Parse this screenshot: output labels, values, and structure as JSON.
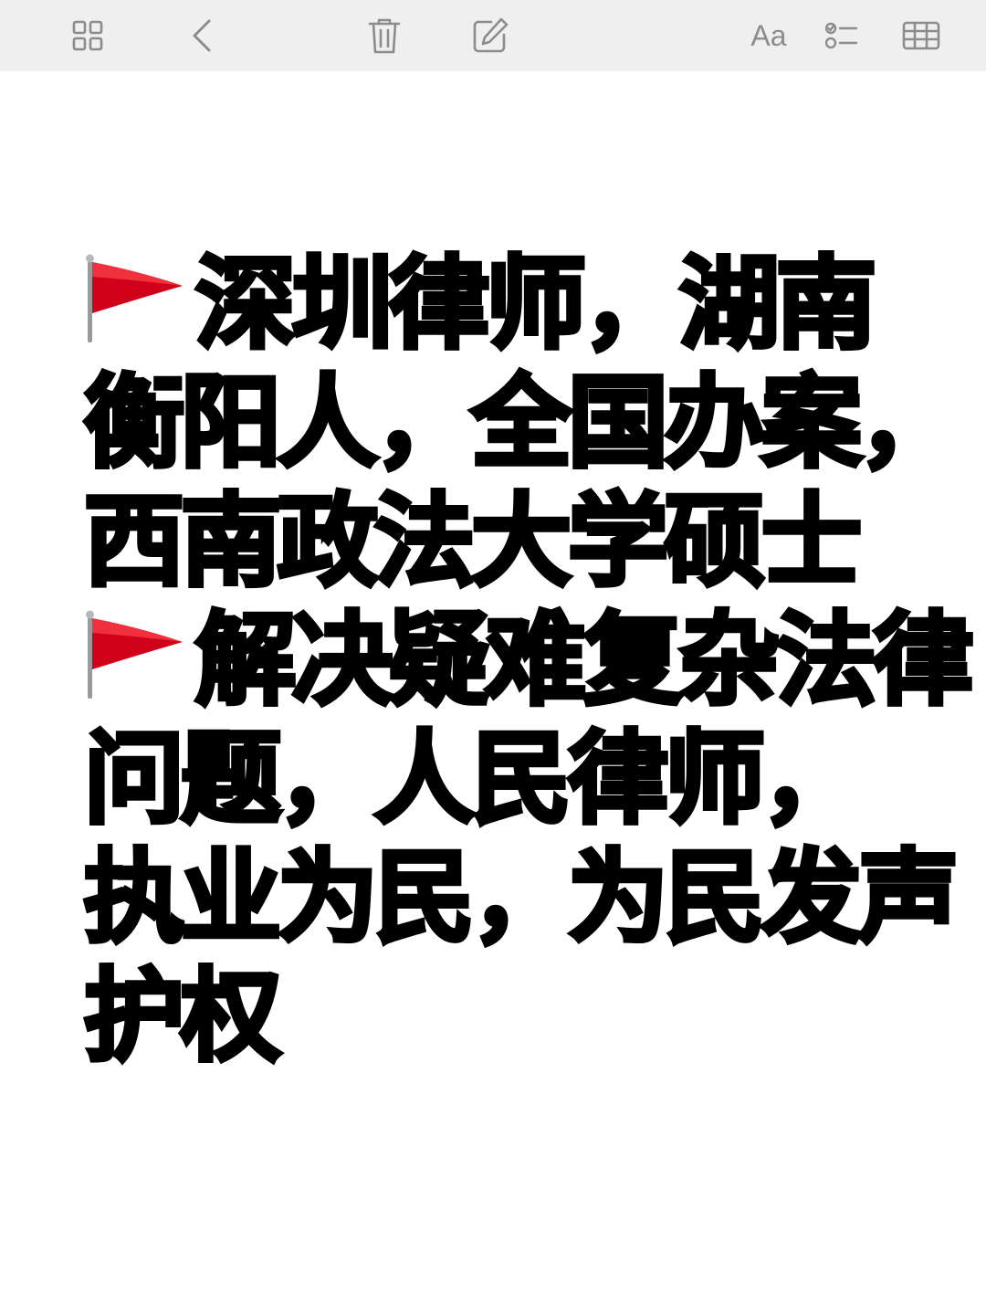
{
  "toolbar": {
    "aa_label": "Aa",
    "icons": [
      "gallery-icon",
      "back-chevron-icon",
      "trash-icon",
      "compose-icon",
      "text-format-icon",
      "checklist-icon",
      "table-icon"
    ]
  },
  "colors": {
    "toolbar_bg": "#efefef",
    "icon_gray": "#8c8c8c",
    "highlight_green": "#7de8a4",
    "text": "#000000",
    "flag_red": "#d0021b"
  },
  "note": {
    "line1": {
      "highlight": "深圳律师",
      "rest": "，湖南"
    },
    "line2": {
      "before": "衡阳人，",
      "highlight": "全国办案",
      "rest": "，"
    },
    "line3": {
      "text": "西南政法大学硕士"
    },
    "line4": {
      "text": "解决疑难复杂法律"
    },
    "line5": {
      "text": "问题，人民律师，"
    },
    "line6": {
      "highlight": "执业为民",
      "rest": "，为民发声"
    },
    "line7": {
      "text": "护权"
    }
  }
}
